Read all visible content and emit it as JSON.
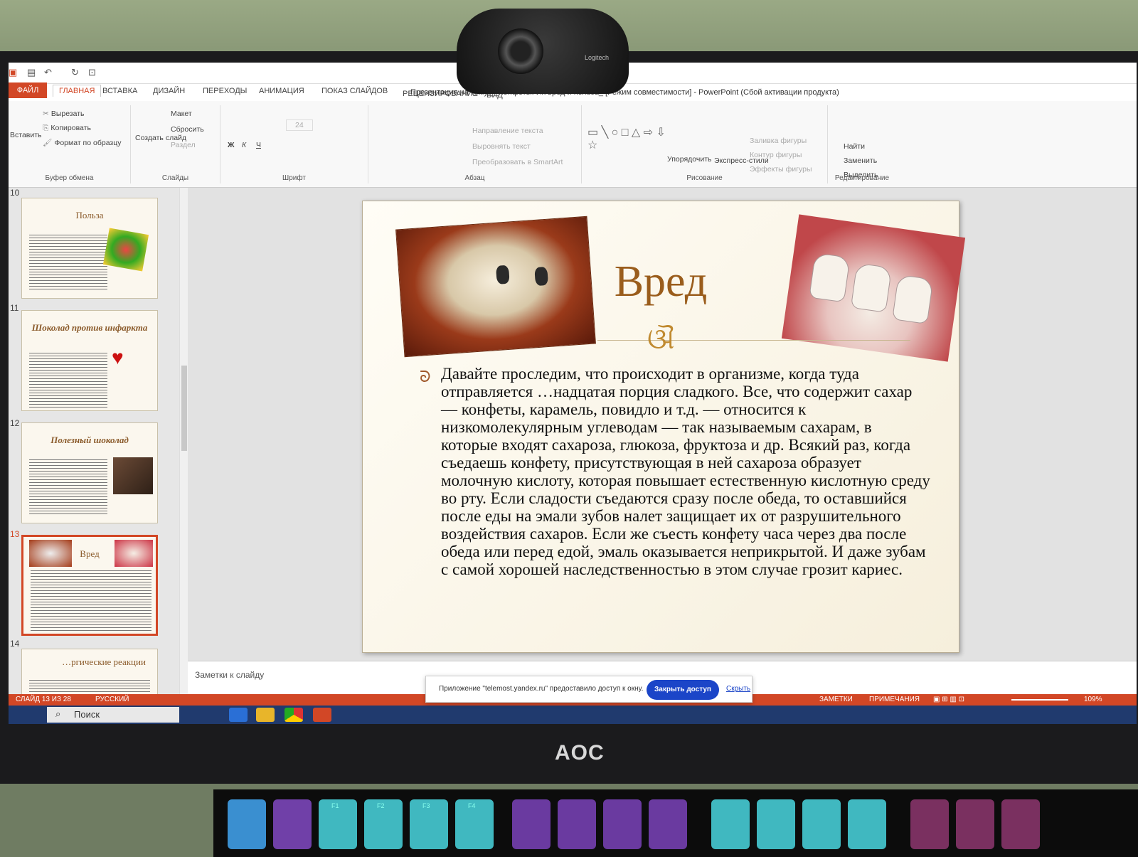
{
  "webcam": {
    "brand": "Logitech"
  },
  "titlebar": {
    "title": "Презентация на тему_ _Конфеты. Их вред и польза_ [Режим совместимости] - PowerPoint (Сбой активации продукта)"
  },
  "tabs": {
    "file": "ФАЙЛ",
    "home": "ГЛАВНАЯ",
    "insert": "ВСТАВКА",
    "design": "ДИЗАЙН",
    "transitions": "ПЕРЕХОДЫ",
    "animation": "АНИМАЦИЯ",
    "slideshow": "ПОКАЗ СЛАЙДОВ",
    "review": "РЕЦЕНЗИРОВАНИЕ",
    "view": "ВИД"
  },
  "ribbon": {
    "clipboard": {
      "paste": "Вставить",
      "cut": "Вырезать",
      "copy": "Копировать",
      "format": "Формат по образцу",
      "label": "Буфер обмена"
    },
    "slides": {
      "new": "Создать слайд",
      "layout": "Макет",
      "reset": "Сбросить",
      "section": "Раздел",
      "label": "Слайды"
    },
    "font": {
      "size": "24",
      "label": "Шрифт"
    },
    "paragraph": {
      "direction": "Направление текста",
      "align": "Выровнять текст",
      "smartart": "Преобразовать в SmartArt",
      "label": "Абзац"
    },
    "drawing": {
      "arrange": "Упорядочить",
      "styles": "Экспресс-стили",
      "fill": "Заливка фигуры",
      "outline": "Контур фигуры",
      "effects": "Эффекты фигуры",
      "label": "Рисование"
    },
    "editing": {
      "find": "Найти",
      "replace": "Заменить",
      "select": "Выделить",
      "label": "Редактирование"
    }
  },
  "thumbnails": [
    {
      "num": "10",
      "title": "Польза"
    },
    {
      "num": "11",
      "title": "Шоколад против инфаркта"
    },
    {
      "num": "12",
      "title": "Полезный шоколад"
    },
    {
      "num": "13",
      "title": "Вред"
    },
    {
      "num": "14",
      "title": "…ргические реакции"
    }
  ],
  "slide": {
    "title": "Вред",
    "flourish": "ଔ",
    "bullet": "ᘐ",
    "body": "Давайте проследим, что происходит в организме, когда туда отправляется …надцатая порция сладкого. Все, что содержит сахар — конфеты, карамель, повидло и т.д. — относится к низкомолекулярным углеводам — так называемым сахарам, в которые входят сахароза, глюкоза, фруктоза и др. Всякий раз, когда съедаешь конфету, присутствующая в ней сахароза образует молочную кислоту, которая повышает естественную кислотную среду во рту. Если сладости съедаются сразу после обеда, то оставшийся после еды на эмали зубов налет защищает их от разрушительного воздействия сахаров. Если же съесть конфету часа через два после обеда или перед едой, эмаль оказывается неприкрытой. И даже зубам с самой хорошей наследственностью в этом случае грозит кариес."
  },
  "notes": {
    "placeholder": "Заметки к слайду"
  },
  "share": {
    "text": "Приложение \"telemost.yandex.ru\" предоставило доступ к окну.",
    "close": "Закрыть доступ",
    "hide": "Скрыть"
  },
  "status": {
    "slide": "СЛАЙД 13 ИЗ 28",
    "lang": "РУССКИЙ",
    "notes": "ЗАМЕТКИ",
    "comments": "ПРИМЕЧАНИЯ",
    "zoom": "109%"
  },
  "taskbar": {
    "search": "Поиск"
  },
  "monitor": {
    "brand": "AOC"
  },
  "keys": [
    "F1",
    "F2",
    "F3",
    "F4"
  ],
  "colors": {
    "accent": "#d24726",
    "title": "#9a5d1c",
    "share_button": "#1b45c8"
  }
}
